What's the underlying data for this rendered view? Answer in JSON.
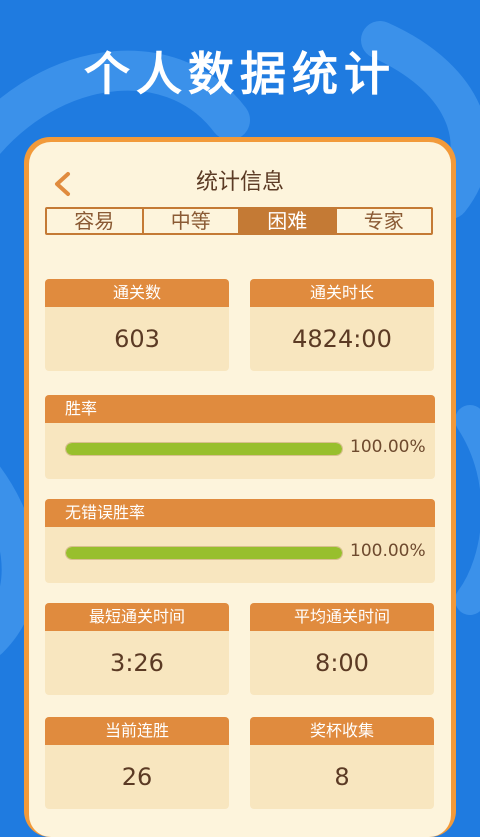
{
  "headline": "个人数据统计",
  "title": "统计信息",
  "tabs": [
    "容易",
    "中等",
    "困难",
    "专家"
  ],
  "active_tab": 2,
  "stats_row1": [
    {
      "label": "通关数",
      "value": "603"
    },
    {
      "label": "通关时长",
      "value": "4824:00"
    }
  ],
  "win_rate": {
    "label": "胜率",
    "value_text": "100.00%",
    "fraction": 1.0
  },
  "perfect_rate": {
    "label": "无错误胜率",
    "value_text": "100.00%",
    "fraction": 1.0
  },
  "stats_row2": [
    {
      "label": "最短通关时间",
      "value": "3:26"
    },
    {
      "label": "平均通关时间",
      "value": "8:00"
    }
  ],
  "stats_row3": [
    {
      "label": "当前连胜",
      "value": "26"
    },
    {
      "label": "奖杯收集",
      "value": "8"
    }
  ],
  "colors": {
    "background": "#1f7be0",
    "accent": "#e08b3e",
    "bar": "#98bf2d"
  }
}
